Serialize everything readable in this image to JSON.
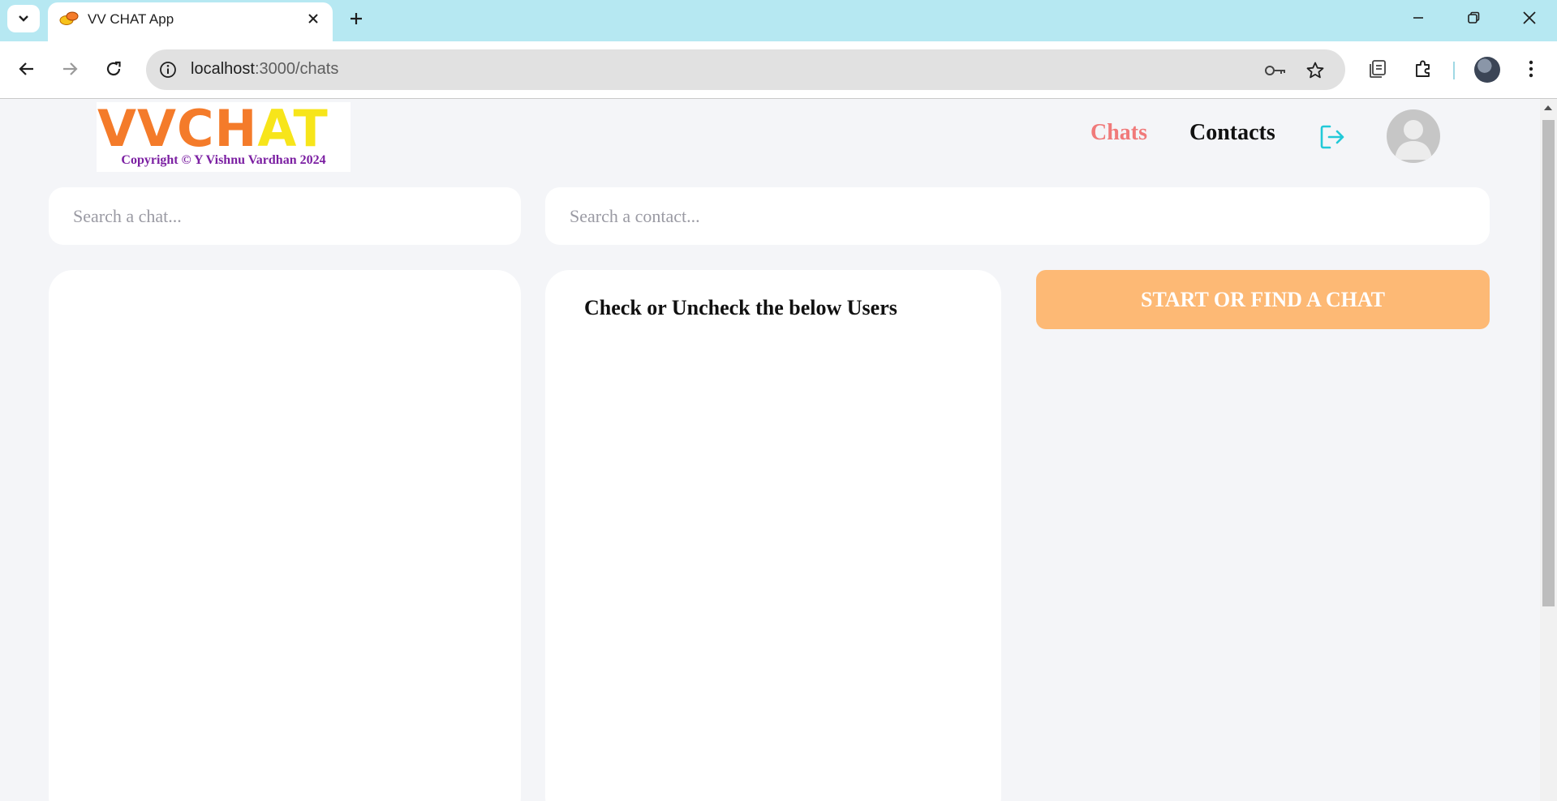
{
  "browser": {
    "tab_title": "VV CHAT App",
    "url_host": "localhost",
    "url_path": ":3000/chats"
  },
  "page": {
    "logo": {
      "letters_v": "VV",
      "letters_ch": "CH",
      "letters_at": "AT",
      "copyright": "Copyright © Y Vishnu Vardhan 2024"
    },
    "nav": {
      "chats": "Chats",
      "contacts": "Contacts"
    },
    "search_chat": {
      "placeholder": "Search a chat..."
    },
    "search_contact": {
      "placeholder": "Search a contact..."
    },
    "users_panel": {
      "title": "Check or Uncheck the below Users"
    },
    "start_button": "START OR FIND A CHAT"
  },
  "colors": {
    "tabbar": "#b6e8f2",
    "nav_active": "#f07a7a",
    "logout": "#22c9d8",
    "start_button": "#fdb975",
    "page_bg": "#f4f5f8"
  }
}
